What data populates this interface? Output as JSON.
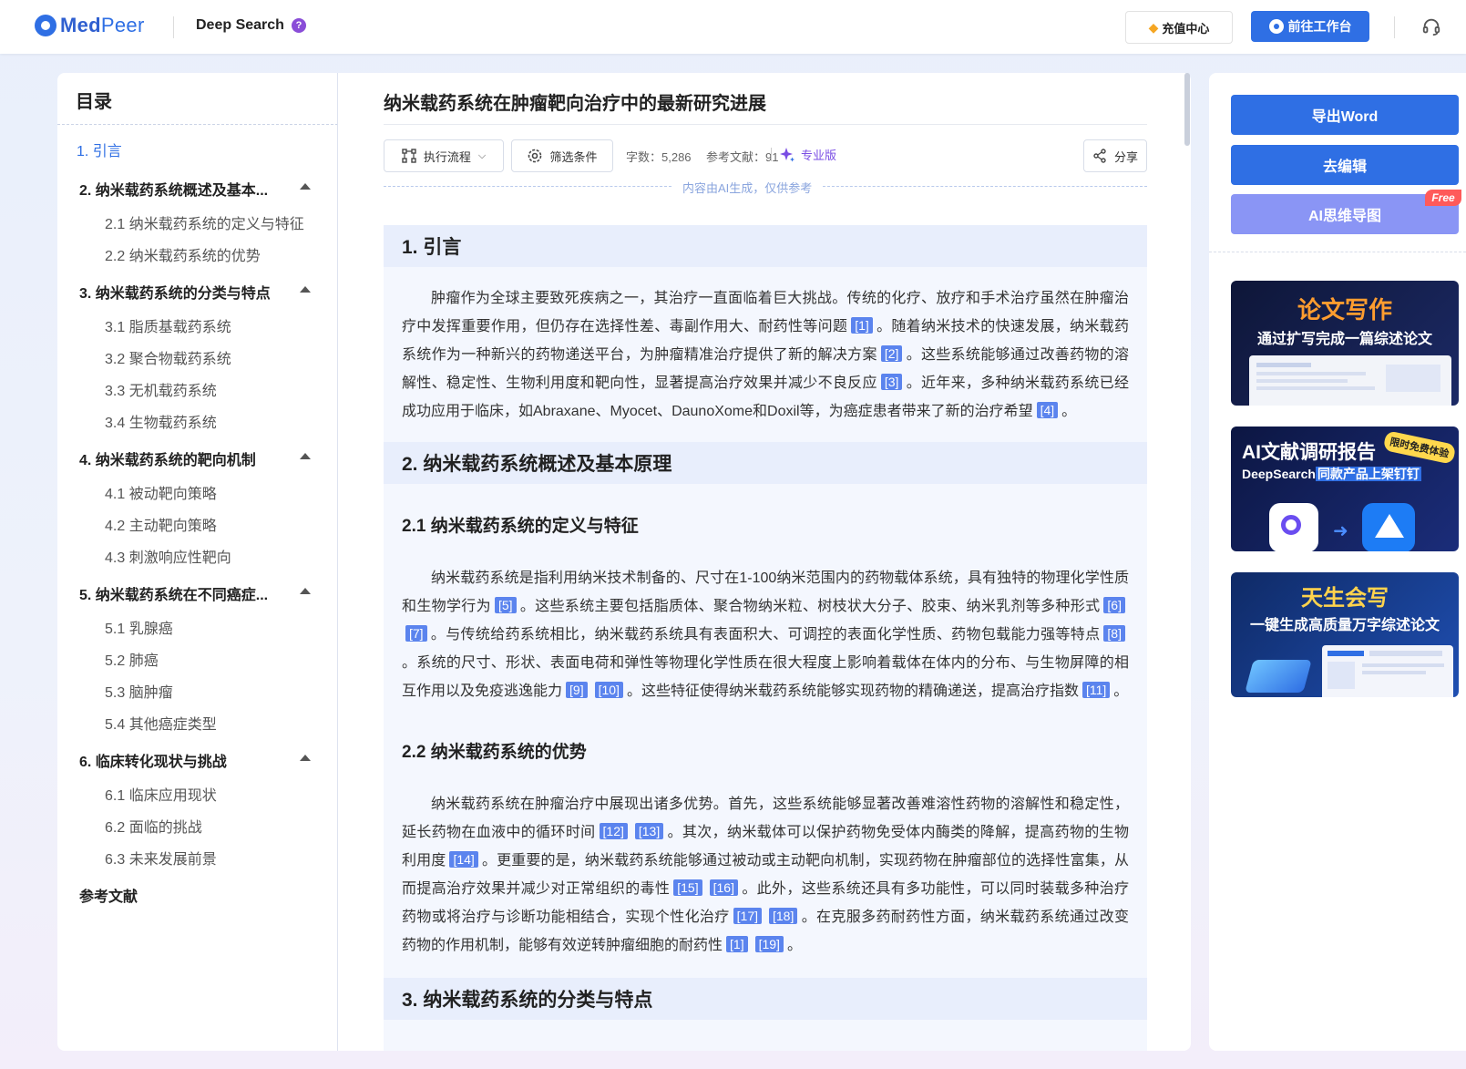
{
  "header": {
    "logo_med": "Med",
    "logo_peer": "Peer",
    "product": "Deep Search",
    "help": "?",
    "recharge_label": "充值中心",
    "workbench_label": "前往工作台"
  },
  "toc": {
    "title": "目录",
    "items": [
      {
        "label": "1. 引言"
      },
      {
        "label": "2. 纳米载药系统概述及基本..."
      },
      {
        "label": "2.1 纳米载药系统的定义与特征"
      },
      {
        "label": "2.2 纳米载药系统的优势"
      },
      {
        "label": "3. 纳米载药系统的分类与特点"
      },
      {
        "label": "3.1 脂质基载药系统"
      },
      {
        "label": "3.2 聚合物载药系统"
      },
      {
        "label": "3.3 无机载药系统"
      },
      {
        "label": "3.4 生物载药系统"
      },
      {
        "label": "4. 纳米载药系统的靶向机制"
      },
      {
        "label": "4.1 被动靶向策略"
      },
      {
        "label": "4.2 主动靶向策略"
      },
      {
        "label": "4.3 刺激响应性靶向"
      },
      {
        "label": "5. 纳米载药系统在不同癌症..."
      },
      {
        "label": "5.1 乳腺癌"
      },
      {
        "label": "5.2 肺癌"
      },
      {
        "label": "5.3 脑肿瘤"
      },
      {
        "label": "5.4 其他癌症类型"
      },
      {
        "label": "6. 临床转化现状与挑战"
      },
      {
        "label": "6.1 临床应用现状"
      },
      {
        "label": "6.2 面临的挑战"
      },
      {
        "label": "6.3 未来发展前景"
      },
      {
        "label": "参考文献"
      }
    ]
  },
  "article": {
    "title": "纳米载药系统在肿瘤靶向治疗中的最新研究进展",
    "toolbar": {
      "flow_label": "执行流程",
      "filter_label": "筛选条件",
      "word_count": "字数：5,286",
      "ref_count": "参考文献：91",
      "pro_label": "专业版",
      "share_label": "分享"
    },
    "ai_notice": "内容由AI生成，仅供参考",
    "s1": {
      "heading": "1. 引言",
      "t1": "肿瘤作为全球主要致死疾病之一，其治疗一直面临着巨大挑战。传统的化疗、放疗和手术治疗虽然在肿瘤治疗中发挥重要作用，但仍存在选择性差、毒副作用大、耐药性等问题",
      "c1": "[1]",
      "t2": "。随着纳米技术的快速发展，纳米载药系统作为一种新兴的药物递送平台，为肿瘤精准治疗提供了新的解决方案",
      "c2": "[2]",
      "t3": "。这些系统能够通过改善药物的溶解性、稳定性、生物利用度和靶向性，显著提高治疗效果并减少不良反应",
      "c3": "[3]",
      "t4": "。近年来，多种纳米载药系统已经成功应用于临床，如Abraxane、Myocet、DaunoXome和Doxil等，为癌症患者带来了新的治疗希望",
      "c4": "[4]",
      "t5": "。"
    },
    "s2": {
      "heading": "2. 纳米载药系统概述及基本原理",
      "sub1": "2.1 纳米载药系统的定义与特征",
      "p1": {
        "t1": "纳米载药系统是指利用纳米技术制备的、尺寸在1-100纳米范围内的药物载体系统，具有独特的物理化学性质和生物学行为",
        "c1": "[5]",
        "t2": "。这些系统主要包括脂质体、聚合物纳米粒、树枝状大分子、胶束、纳米乳剂等多种形式",
        "c2": "[6]",
        "c3": "[7]",
        "t3": "。与传统给药系统相比，纳米载药系统具有表面积大、可调控的表面化学性质、药物包载能力强等特点",
        "c4": "[8]",
        "t4": "。系统的尺寸、形状、表面电荷和弹性等物理化学性质在很大程度上影响着载体在体内的分布、与生物屏障的相互作用以及免疫逃逸能力",
        "c5": "[9]",
        "c6": "[10]",
        "t5": "。这些特征使得纳米载药系统能够实现药物的精确递送，提高治疗指数",
        "c7": "[11]",
        "t6": "。"
      },
      "sub2": "2.2 纳米载药系统的优势",
      "p2": {
        "t1": "纳米载药系统在肿瘤治疗中展现出诸多优势。首先，这些系统能够显著改善难溶性药物的溶解性和稳定性，延长药物在血液中的循环时间",
        "c1": "[12]",
        "c2": "[13]",
        "t2": "。其次，纳米载体可以保护药物免受体内酶类的降解，提高药物的生物利用度",
        "c3": "[14]",
        "t3": "。更重要的是，纳米载药系统能够通过被动或主动靶向机制，实现药物在肿瘤部位的选择性富集，从而提高治疗效果并减少对正常组织的毒性",
        "c4": "[15]",
        "c5": "[16]",
        "t4": "。此外，这些系统还具有多功能性，可以同时装载多种治疗药物或将治疗与诊断功能相结合，实现个性化治疗",
        "c6": "[17]",
        "c7": "[18]",
        "t5": "。在克服多药耐药性方面，纳米载药系统通过改变药物的作用机制，能够有效逆转肿瘤细胞的耐药性",
        "c8": "[1]",
        "c9": "[19]",
        "t6": "。"
      }
    },
    "s3": {
      "heading": "3. 纳米载药系统的分类与特点"
    }
  },
  "sidebar": {
    "export_word": "导出Word",
    "edit": "去编辑",
    "mindmap": "AI思维导图",
    "free_tag": "Free",
    "promo1": {
      "title": "论文写作",
      "subtitle": "通过扩写完成一篇综述论文"
    },
    "promo2": {
      "title": "AI文献调研报告",
      "badge": "限时免费体验",
      "line": "DeepSearch",
      "line_hl": "同款产品上架钉钉"
    },
    "promo3": {
      "title": "天生会写",
      "subtitle": "一键生成高质量万字综述论文"
    }
  },
  "colors": {
    "accent": "#2f6fe4",
    "citation": "#5b84ee",
    "section_bg": "#e8eefc",
    "content_bg": "#f4f7fe",
    "pro": "#7a4de4",
    "mindmap_button": "#8a95f5"
  }
}
